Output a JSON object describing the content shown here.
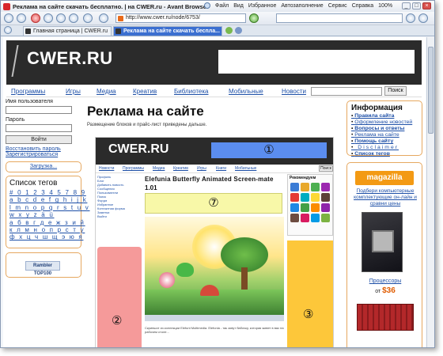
{
  "window": {
    "title": "Реклама на сайте скачать бесплатно. | на CWER.ru - Avant Browser",
    "menu": [
      "Файл",
      "Вид",
      "Избранное",
      "Автозаполнение",
      "Сервис",
      "Справка",
      "100%"
    ],
    "buttons": [
      "_",
      "□",
      "×"
    ]
  },
  "toolbar": {
    "address": "http://www.cwer.ru/node/6753/"
  },
  "tabs": [
    {
      "label": "Главная страница | CWER.ru",
      "active": false
    },
    {
      "label": "Реклама на сайте скачать беспла...",
      "active": true
    }
  ],
  "site": {
    "logo": "CWER.RU",
    "nav": [
      "Программы",
      "Игры",
      "Медиа",
      "Креатив",
      "Библиотека",
      "Мобильные",
      "Новости"
    ],
    "search_button": "Поиск"
  },
  "login": {
    "username_label": "Имя пользователя",
    "password_label": "Пароль",
    "submit": "Войти",
    "restore": "Восстановить пароль",
    "register": "Зарегистрироваться"
  },
  "download_link": "Загрузка...",
  "tags": {
    "title": "Список тегов",
    "rows": [
      "# 0 1 2 3 4 5 7 8 9",
      "a b c d e f g h i j k",
      "l m n o p q r s t u v",
      "w x y z ä ü",
      "а б в г д е ж з и й",
      "к л м н о п р с т у",
      "ф х ц ч ш щ э ю я"
    ]
  },
  "rambler": "Rambler TOP100",
  "main": {
    "title": "Реклама на сайте",
    "subtitle": "Размещение блоков и прайс-лист приведены дальше."
  },
  "shot": {
    "logo": "CWER.RU",
    "zones": [
      "①",
      "②",
      "③",
      "⑦"
    ],
    "nav": [
      "Новости",
      "Программы",
      "Медиа",
      "Креатив",
      "Игры",
      "Книги",
      "Мобильные"
    ],
    "search_button": "Поиск",
    "left_links": [
      "Профиль",
      "Блог",
      "Добавить новость",
      "Сообщения",
      "Пользователи",
      "Поиск",
      "Форум",
      "Избранное",
      "Контактная форма",
      "Заметки",
      "Выйти"
    ],
    "title_line1": "Elefunia Butterfly Animated Screen-mate",
    "title_line2": "1.01",
    "recommend_title": "Рекомендуем",
    "caption": "Скриншот из коллекции Elefunt Multimedia. Elefunia - так зовут бабочку, которая живет в вас на рабочем столе..."
  },
  "info": {
    "title": "Информация",
    "links": [
      {
        "label": "Правила сайта",
        "bold": true
      },
      {
        "label": "Оформление новостей",
        "bold": false
      },
      {
        "label": "Вопросы и ответы",
        "bold": true
      },
      {
        "label": "Реклама на сайте",
        "bold": false
      },
      {
        "label": "Помощь сайту",
        "bold": true
      },
      {
        "label": "Disclaimer",
        "bold": false
      },
      {
        "label": "Список тегов",
        "bold": true
      }
    ]
  },
  "ad": {
    "brand": "magazilla",
    "text": "Подбери компьютерные комплектующие он-лайн и сравни цены",
    "label": "Процессоры",
    "price_prefix": "от",
    "price": "$36"
  },
  "colors": {
    "zone1": "#5b8def",
    "zone2": "#f59a9a",
    "zone3": "#fdc73a",
    "zone7": "#f8f8a8",
    "box_border": "#e6a860",
    "link": "#1d4fa7",
    "header_bg": "#2b2b2b"
  }
}
